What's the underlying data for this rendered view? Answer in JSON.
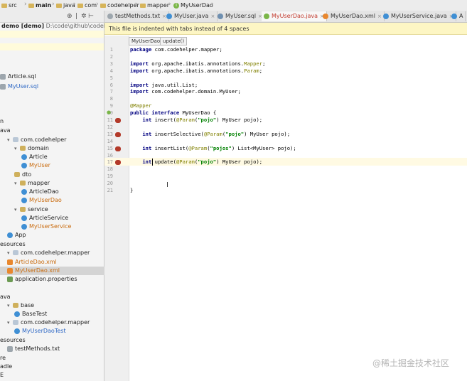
{
  "breadcrumb": [
    "src",
    "main",
    "java",
    "com",
    "codehelper",
    "mapper",
    "MyUserDao"
  ],
  "project": {
    "root_label": "demo [demo]",
    "root_path": "D:\\code\\github\\codehelpe",
    "nodes": [
      {
        "text": "Article.sql",
        "icon": "txt",
        "color": "default"
      },
      {
        "text": "MyUser.sql",
        "icon": "txt",
        "color": "blue"
      },
      {
        "text": "n",
        "icon": "none",
        "color": "default"
      },
      {
        "text": "ava",
        "icon": "none",
        "color": "default"
      },
      {
        "text": "com.codehelper",
        "icon": "pkg",
        "color": "default"
      },
      {
        "text": "domain",
        "icon": "folder",
        "color": "default"
      },
      {
        "text": "Article",
        "icon": "cls",
        "color": "default"
      },
      {
        "text": "MyUser",
        "icon": "cls",
        "color": "orange"
      },
      {
        "text": "dto",
        "icon": "folder",
        "color": "default"
      },
      {
        "text": "mapper",
        "icon": "folder",
        "color": "default"
      },
      {
        "text": "ArticleDao",
        "icon": "cls",
        "color": "default"
      },
      {
        "text": "MyUserDao",
        "icon": "cls",
        "color": "orange"
      },
      {
        "text": "service",
        "icon": "folder",
        "color": "default"
      },
      {
        "text": "ArticleService",
        "icon": "cls",
        "color": "default"
      },
      {
        "text": "MyUserService",
        "icon": "cls",
        "color": "orange"
      },
      {
        "text": "App",
        "icon": "cls",
        "color": "default"
      },
      {
        "text": "esources",
        "icon": "none",
        "color": "default"
      },
      {
        "text": "com.codehelper.mapper",
        "icon": "pkg",
        "color": "default"
      },
      {
        "text": "ArticleDao.xml",
        "icon": "xml",
        "color": "orange"
      },
      {
        "text": "MyUserDao.xml",
        "icon": "xml",
        "color": "orange"
      },
      {
        "text": "application.properties",
        "icon": "props",
        "color": "default"
      },
      {
        "text": "ava",
        "icon": "none",
        "color": "default"
      },
      {
        "text": "base",
        "icon": "folder",
        "color": "default"
      },
      {
        "text": "BaseTest",
        "icon": "cls",
        "color": "default"
      },
      {
        "text": "com.codehelper.mapper",
        "icon": "pkg",
        "color": "default"
      },
      {
        "text": "MyUserDaoTest",
        "icon": "cls",
        "color": "blue"
      },
      {
        "text": "esources",
        "icon": "none",
        "color": "default"
      },
      {
        "text": "testMethods.txt",
        "icon": "txt",
        "color": "default"
      },
      {
        "text": "re",
        "icon": "none",
        "color": "default"
      },
      {
        "text": "adle",
        "icon": "none",
        "color": "default"
      },
      {
        "text": "E",
        "icon": "none",
        "color": "default"
      }
    ]
  },
  "tabs": [
    {
      "label": "testMethods.txt",
      "active": false
    },
    {
      "label": "MyUser.java",
      "active": false
    },
    {
      "label": "MyUser.sql",
      "active": false
    },
    {
      "label": "MyUserDao.java",
      "active": true
    },
    {
      "label": "MyUserDao.xml",
      "active": false
    },
    {
      "label": "MyUserService.java",
      "active": false
    },
    {
      "label": "A",
      "active": false
    }
  ],
  "banner": "This file is indented with tabs instead of 4 spaces",
  "editor_breadcrumb": [
    "MyUserDao",
    "update()"
  ],
  "code_lines": [
    {
      "n": "1",
      "text": "package com.codehelper.mapper;"
    },
    {
      "n": "2",
      "text": ""
    },
    {
      "n": "3",
      "text": "import org.apache.ibatis.annotations.Mapper;"
    },
    {
      "n": "4",
      "text": "import org.apache.ibatis.annotations.Param;"
    },
    {
      "n": "5",
      "text": ""
    },
    {
      "n": "6",
      "text": "import java.util.List;"
    },
    {
      "n": "7",
      "text": "import com.codehelper.domain.MyUser;"
    },
    {
      "n": "8",
      "text": ""
    },
    {
      "n": "9",
      "text": "@Mapper"
    },
    {
      "n": "10",
      "text": "public interface MyUserDao {"
    },
    {
      "n": "11",
      "text": "    int insert(@Param(\"pojo\") MyUser pojo);"
    },
    {
      "n": "12",
      "text": ""
    },
    {
      "n": "13",
      "text": "    int insertSelective(@Param(\"pojo\") MyUser pojo);"
    },
    {
      "n": "14",
      "text": ""
    },
    {
      "n": "15",
      "text": "    int insertList(@Param(\"pojos\") List<MyUser> pojo);"
    },
    {
      "n": "16",
      "text": ""
    },
    {
      "n": "17",
      "text": "    int update(@Param(\"pojo\") MyUser pojo);"
    },
    {
      "n": "18",
      "text": ""
    },
    {
      "n": "19",
      "text": ""
    },
    {
      "n": "20",
      "text": ""
    },
    {
      "n": "21",
      "text": "}"
    }
  ],
  "watermark": "@稀土掘金技术社区",
  "colors": {
    "keyword": "#000080",
    "annotation": "#808000",
    "string": "#008000",
    "active_tab": "#c23a2e",
    "modified_file": "#c96a0c"
  }
}
